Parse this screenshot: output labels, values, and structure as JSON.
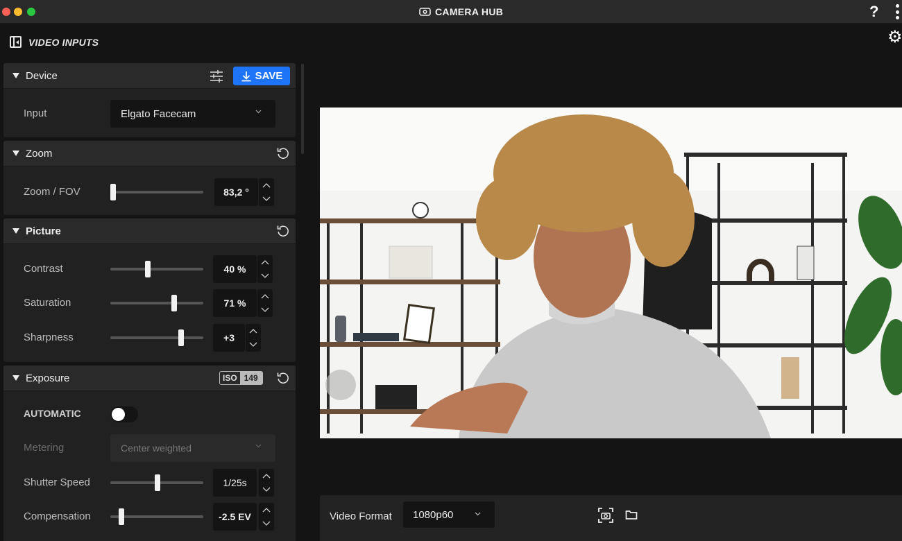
{
  "app": {
    "title": "CAMERA HUB"
  },
  "sidebar": {
    "title": "VIDEO INPUTS"
  },
  "device": {
    "title": "Device",
    "save_label": "SAVE",
    "input_label": "Input",
    "input_value": "Elgato Facecam"
  },
  "zoom": {
    "title": "Zoom",
    "fov_label": "Zoom / FOV",
    "fov_value": "83,2 °",
    "fov_level": 0.03
  },
  "picture": {
    "title": "Picture",
    "contrast_label": "Contrast",
    "contrast_value": "40 %",
    "contrast_level": 0.4,
    "saturation_label": "Saturation",
    "saturation_value": "71 %",
    "saturation_level": 0.69,
    "sharpness_label": "Sharpness",
    "sharpness_value": "+3",
    "sharpness_level": 0.76
  },
  "exposure": {
    "title": "Exposure",
    "iso_label": "ISO",
    "iso_value": "149",
    "automatic_label": "AUTOMATIC",
    "automatic_on": false,
    "metering_label": "Metering",
    "metering_value": "Center weighted",
    "shutter_label": "Shutter Speed",
    "shutter_value": "1/25s",
    "shutter_level": 0.51,
    "compensation_label": "Compensation",
    "compensation_value": "-2.5 EV",
    "compensation_level": 0.12
  },
  "preview": {
    "format_label": "Video Format",
    "format_value": "1080p60"
  },
  "colors": {
    "accent": "#1e74f6",
    "panel": "#212121",
    "header": "#2a2a2a",
    "field": "#141414"
  }
}
